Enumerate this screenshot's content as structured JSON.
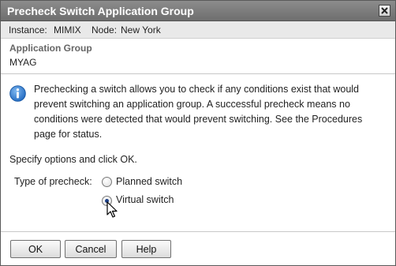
{
  "dialog": {
    "title": "Precheck Switch Application Group",
    "close_icon": "close-icon"
  },
  "context": {
    "instance_label": "Instance:",
    "instance_value": "MIMIX",
    "node_label": "Node:",
    "node_value": "New York"
  },
  "application_group": {
    "label": "Application Group",
    "value": "MYAG"
  },
  "info": {
    "icon": "info-icon",
    "text": "Prechecking a switch allows you to check if any conditions exist that would prevent switching an application group. A successful precheck means no conditions were detected that would prevent switching. See the Procedures page for status."
  },
  "form": {
    "instructions": "Specify options and click OK.",
    "type_label": "Type of precheck:",
    "options": [
      {
        "label": "Planned switch",
        "selected": false
      },
      {
        "label": "Virtual switch",
        "selected": true
      }
    ]
  },
  "buttons": {
    "ok": "OK",
    "cancel": "Cancel",
    "help": "Help"
  },
  "colors": {
    "titlebar": "#7d7d7d",
    "info_icon": "#2f7fd6",
    "radio_dot": "#1b3f86"
  }
}
